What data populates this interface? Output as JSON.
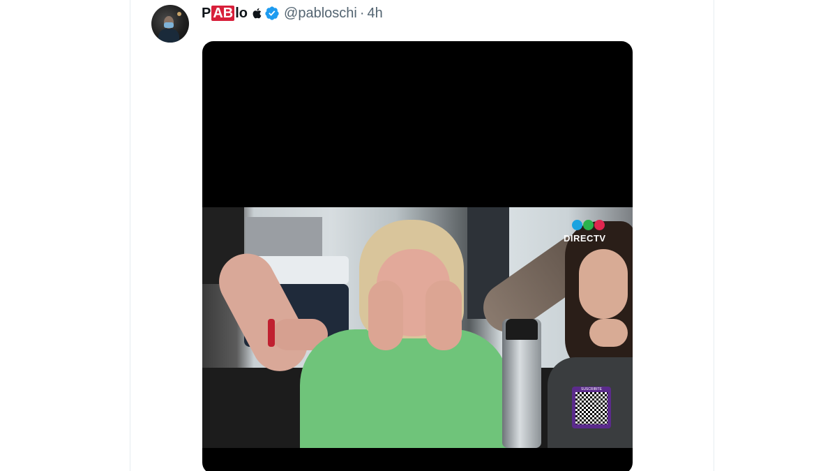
{
  "tweet": {
    "author": {
      "name_prefix": "P",
      "name_box": "AB",
      "name_suffix": "lo",
      "handle": "@pabloschi",
      "separator": "·",
      "time": "4h"
    },
    "icons": {
      "avatar": "avatar",
      "apple": "apple-icon",
      "verified": "verified-badge-icon"
    },
    "colors": {
      "verified": "#1d9bf0",
      "name_box": "#d81f3a",
      "muted_text": "#536471"
    }
  },
  "video": {
    "brand": "DIRECTV",
    "brand_dots": [
      "#1aa3e0",
      "#2bb24c",
      "#e0264f"
    ],
    "qr_label": "SUSCRIBITE"
  }
}
